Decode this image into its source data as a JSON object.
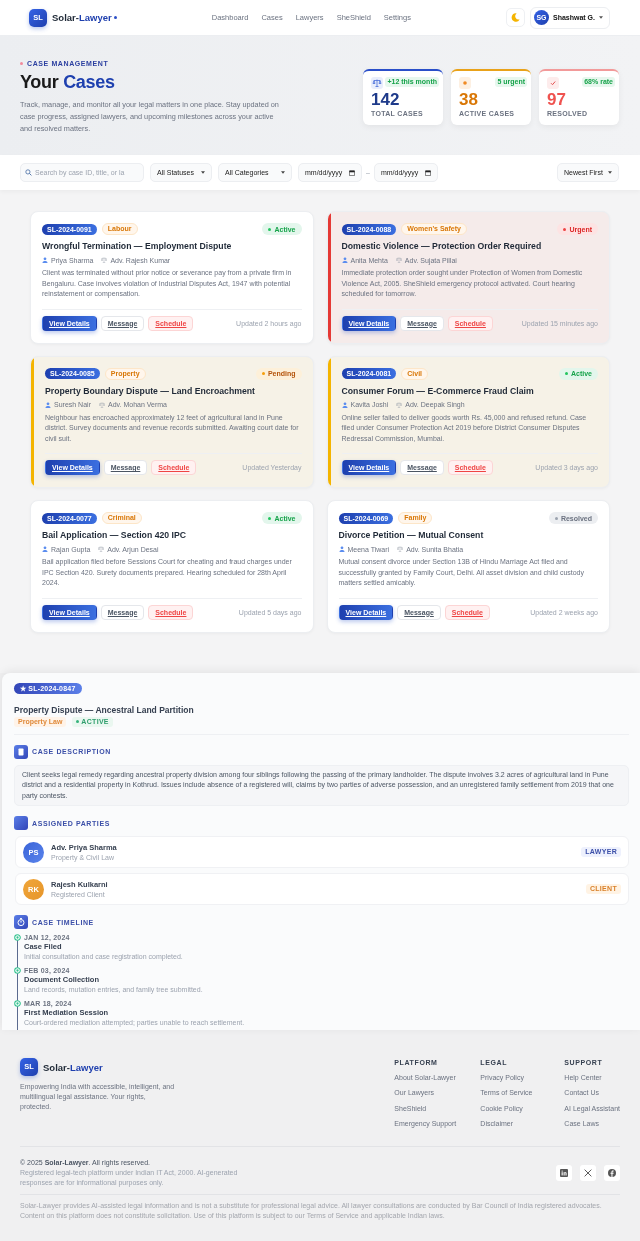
{
  "header": {
    "logo": "SL",
    "brand_main": "Solar-",
    "brand_accent": "Lawyer",
    "nav": [
      "Dashboard",
      "Cases",
      "Lawyers",
      "SheShield",
      "Settings"
    ],
    "user": {
      "initials": "SG",
      "name": "Shashwat G."
    }
  },
  "hero": {
    "eyebrow": "CASE MANAGEMENT",
    "title": "Your",
    "title_highlight": "Cases",
    "description": "Track, manage, and monitor all your legal matters in one place. Stay updated on case progress, assigned lawyers, and upcoming milestones across your active and resolved matters.",
    "stats": [
      {
        "kind": "total",
        "badge": "+12 this month",
        "value": "142",
        "label": "TOTAL CASES"
      },
      {
        "kind": "active",
        "badge": "5 urgent",
        "value": "38",
        "label": "ACTIVE CASES"
      },
      {
        "kind": "resolved",
        "badge": "68% rate",
        "value": "97",
        "label": "RESOLVED"
      }
    ]
  },
  "filters": {
    "search": {
      "placeholder": "Search by case ID, title, or la"
    },
    "status": "All Statuses",
    "category": "All Categories",
    "date_from": {
      "placeholder": "mm/dd/yyyy"
    },
    "date_separator": "–",
    "date_to": {
      "placeholder": "mm/dd/yyyy"
    },
    "sort": "Newest First"
  },
  "cases": [
    {
      "id": "SL-2024-0091",
      "category": "Labour",
      "status": {
        "label": "Active",
        "kind": "active"
      },
      "title": "Wrongful Termination — Employment Dispute",
      "client": "Priya Sharma",
      "advocate": "Adv. Rajesh Kumar",
      "description": "Client was terminated without prior notice or severance pay from a private firm in Bengaluru. Case involves violation of Industrial Disputes Act, 1947 with potential reinstatement or compensation.",
      "actions": [
        {
          "label": "View Details",
          "kind": "primary"
        },
        {
          "label": "Message",
          "kind": "secondary"
        },
        {
          "label": "Schedule",
          "kind": "danger"
        }
      ],
      "updated": "Updated 2 hours ago"
    },
    {
      "id": "SL-2024-0088",
      "category": "Women's Safety",
      "status": {
        "label": "Urgent",
        "kind": "urgent"
      },
      "color": "#e53935",
      "title": "Domestic Violence — Protection Order Required",
      "client": "Anita Mehta",
      "advocate": "Adv. Sujata Pillai",
      "description": "Immediate protection order sought under Protection of Women from Domestic Violence Act, 2005. SheShield emergency protocol activated. Court hearing scheduled for tomorrow.",
      "actions": [
        {
          "label": "View Details",
          "kind": "primary"
        },
        {
          "label": "Message",
          "kind": "secondary"
        },
        {
          "label": "Schedule",
          "kind": "danger"
        }
      ],
      "updated": "Updated 15 minutes ago"
    },
    {
      "id": "SL-2024-0085",
      "category": "Property",
      "status": {
        "label": "Pending",
        "kind": "pending"
      },
      "color": "#f4b400",
      "title": "Property Boundary Dispute — Land Encroachment",
      "client": "Suresh Nair",
      "advocate": "Adv. Mohan Verma",
      "description": "Neighbour has encroached approximately 12 feet of agricultural land in Pune district. Survey documents and revenue records submitted. Awaiting court date for civil suit.",
      "actions": [
        {
          "label": "View Details",
          "kind": "primary"
        },
        {
          "label": "Message",
          "kind": "secondary"
        },
        {
          "label": "Schedule",
          "kind": "danger"
        }
      ],
      "updated": "Updated Yesterday"
    },
    {
      "id": "SL-2024-0081",
      "category": "Civil",
      "status": {
        "label": "Active",
        "kind": "active"
      },
      "color": "#f4b400",
      "title": "Consumer Forum — E-Commerce Fraud Claim",
      "client": "Kavita Joshi",
      "advocate": "Adv. Deepak Singh",
      "description": "Online seller failed to deliver goods worth Rs. 45,000 and refused refund. Case filed under Consumer Protection Act 2019 before District Consumer Disputes Redressal Commission, Mumbai.",
      "actions": [
        {
          "label": "View Details",
          "kind": "primary"
        },
        {
          "label": "Message",
          "kind": "secondary"
        },
        {
          "label": "Schedule",
          "kind": "danger"
        }
      ],
      "updated": "Updated 3 days ago"
    },
    {
      "id": "SL-2024-0077",
      "category": "Criminal",
      "status": {
        "label": "Active",
        "kind": "active"
      },
      "title": "Bail Application — Section 420 IPC",
      "client": "Rajan Gupta",
      "advocate": "Adv. Arjun Desai",
      "description": "Bail application filed before Sessions Court for cheating and fraud charges under IPC Section 420. Surety documents prepared. Hearing scheduled for 28th April 2024.",
      "actions": [
        {
          "label": "View Details",
          "kind": "primary"
        },
        {
          "label": "Message",
          "kind": "secondary"
        },
        {
          "label": "Schedule",
          "kind": "danger"
        }
      ],
      "updated": "Updated 5 days ago"
    },
    {
      "id": "SL-2024-0069",
      "category": "Family",
      "status": {
        "label": "Resolved",
        "kind": "resolved"
      },
      "title": "Divorce Petition — Mutual Consent",
      "client": "Meena Tiwari",
      "advocate": "Adv. Sunita Bhatia",
      "description": "Mutual consent divorce under Section 13B of Hindu Marriage Act filed and successfully granted by Family Court, Delhi. All asset division and child custody matters settled amicably.",
      "actions": [
        {
          "label": "View Details",
          "kind": "primary"
        },
        {
          "label": "Message",
          "kind": "secondary"
        },
        {
          "label": "Schedule",
          "kind": "danger"
        }
      ],
      "updated": "Updated 2 weeks ago"
    }
  ],
  "detail": {
    "badge": "★ SL-2024-0847",
    "title": "Property Dispute — Ancestral Land Partition",
    "tags": [
      {
        "label": "Property Law",
        "kind": "category"
      },
      {
        "label": "ACTIVE",
        "kind": "status"
      }
    ],
    "description": {
      "heading": "CASE DESCRIPTION",
      "text": "Client seeks legal remedy regarding ancestral property division among four siblings following the passing of the primary landholder. The dispute involves 3.2 acres of agricultural land in Pune district and a residential property in Kothrud. Issues include absence of a registered will, claims by two parties of adverse possession, and an unregistered family settlement from 2019 that one party contests."
    },
    "parties": {
      "heading": "ASSIGNED PARTIES",
      "items": [
        {
          "initials": "PS",
          "name": "Adv. Priya Sharma",
          "subtitle": "Property & Civil Law",
          "role": "LAWYER",
          "kind": "lawyer"
        },
        {
          "initials": "RK",
          "name": "Rajesh Kulkarni",
          "subtitle": "Registered Client",
          "role": "CLIENT",
          "kind": "client"
        }
      ]
    },
    "timeline": {
      "heading": "CASE TIMELINE",
      "events": [
        {
          "date": "JAN 12, 2024",
          "title": "Case Filed",
          "description": "Initial consultation and case registration completed."
        },
        {
          "date": "FEB 03, 2024",
          "title": "Document Collection",
          "description": "Land records, mutation entries, and family tree submitted."
        },
        {
          "date": "MAR 18, 2024",
          "title": "First Mediation Session",
          "description": "Court-ordered mediation attempted; parties unable to reach settlement."
        }
      ]
    }
  },
  "footer": {
    "logo": "SL",
    "brand_main": "Solar-",
    "brand_accent": "Lawyer",
    "tagline": "Empowering India with accessible, intelligent, and multilingual legal assistance. Your rights, protected.",
    "columns": [
      {
        "heading": "PLATFORM",
        "links": [
          "About Solar-Lawyer",
          "Our Lawyers",
          "SheShield",
          "Emergency Support"
        ]
      },
      {
        "heading": "LEGAL",
        "links": [
          "Privacy Policy",
          "Terms of Service",
          "Cookie Policy",
          "Disclaimer"
        ]
      },
      {
        "heading": "SUPPORT",
        "links": [
          "Help Center",
          "Contact Us",
          "AI Legal Assistant",
          "Case Laws"
        ]
      }
    ],
    "copyright": "© 2025 **Solar-Lawyer**. All rights reserved.",
    "registration": "Registered legal-tech platform under Indian IT Act, 2000. AI-generated responses are for informational purposes only.",
    "disclaimer": "Solar-Lawyer provides AI-assisted legal information and is not a substitute for professional legal advice. All lawyer consultations are conducted by Bar Council of India registered advocates. Content on this platform does not constitute solicitation. Use of this platform is subject to our Terms of Service and applicable Indian laws."
  }
}
